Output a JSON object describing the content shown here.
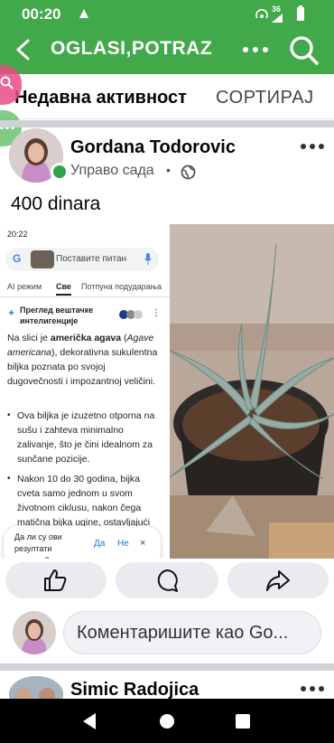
{
  "status_bar": {
    "time": "00:20",
    "network": "36"
  },
  "app_bar": {
    "title": "OGLASI,POTRAZ"
  },
  "sort_header": {
    "title": "Недавна активност",
    "sort_label": "СОРТИРАЈ"
  },
  "post": {
    "author": "Gordana Todorovic",
    "time": "Управо сада",
    "separator": "•",
    "body": "400 dinara",
    "embedded_screenshot": {
      "time": "20:22",
      "search_placeholder": "Поставите питан",
      "tabs": [
        "AI режим",
        "Све",
        "Потпуна подударања"
      ],
      "ai_overview_title": "Преглед вештачке интелигенције",
      "paragraph_1_prefix": "Na slici je ",
      "paragraph_1_bold": "američka agava",
      "paragraph_1_mid": " (",
      "paragraph_1_italic": "Agave americana",
      "paragraph_1_suffix": "), dekorativna sukulentna biljka poznata po svojoj dugovečnosti i impozantnoj veličini.",
      "bullet_1": "Ova biljka je izuzetno otporna na sušu i zahteva minimalno zalivanje, što je čini idealnom za sunčane pozicije.",
      "bullet_2": "Nakon 10 do 30 godina, bijka cveta samo jednom u svom životnom ciklusu, nakon čega matična bijka ugine, ostavljajući",
      "feedback_question": "Да ли су ови резултати корисни?",
      "feedback_yes": "Да",
      "feedback_no": "Не"
    }
  },
  "comment": {
    "placeholder": "Коментаришите као Go..."
  },
  "next_post": {
    "author": "Simic Radojica"
  },
  "colors": {
    "brand_green": "#42a94a",
    "online_green": "#31a24c",
    "google_blue": "#1a73e8"
  },
  "icons": [
    "back-arrow-icon",
    "more-icon",
    "search-icon",
    "globe-icon",
    "like-icon",
    "comment-icon",
    "share-icon"
  ]
}
